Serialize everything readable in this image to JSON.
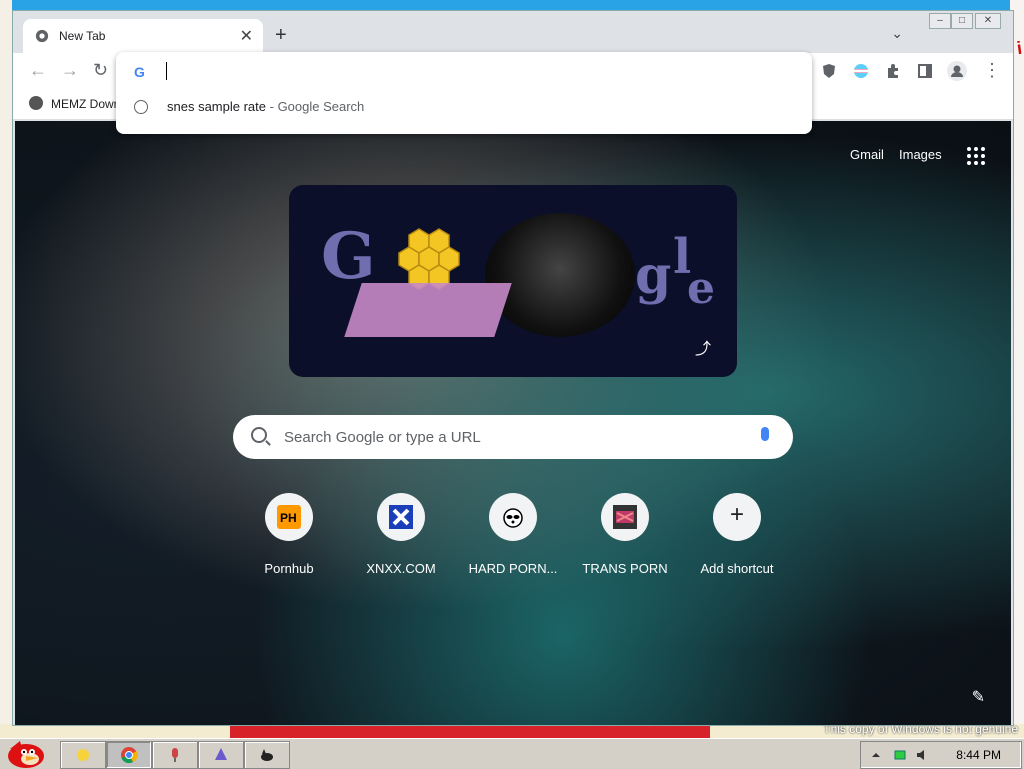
{
  "window": {
    "tab_title": "New Tab",
    "tab_close": "✕",
    "new_tab": "+",
    "tab_search": "⌄",
    "controls": {
      "minimize": "–",
      "maximize": "□",
      "close": "✕"
    }
  },
  "toolbar": {
    "back": "←",
    "forward": "→",
    "reload": "↻",
    "menu": "⋮",
    "extensions": [
      "ublock-icon",
      "pride-extension-icon",
      "puzzle-extension-icon",
      "side-panel-icon",
      "profile-icon"
    ]
  },
  "bookmarks": [
    {
      "label": "MEMZ Down"
    }
  ],
  "omnibox": {
    "value": "",
    "engine_glyph": "G",
    "suggestion": {
      "query": "snes sample rate",
      "separator": " - ",
      "engine": "Google Search"
    }
  },
  "ntp": {
    "links": {
      "gmail": "Gmail",
      "images": "Images"
    },
    "doodle": {
      "letters": [
        "G",
        "g",
        "l",
        "e"
      ],
      "share": "⤴"
    },
    "search_placeholder": "Search Google or type a URL",
    "shortcuts": [
      {
        "label": "Pornhub",
        "icon": "ph-icon"
      },
      {
        "label": "XNXX.COM",
        "icon": "xnxx-icon"
      },
      {
        "label": "HARD PORN...",
        "icon": "raccoon-icon"
      },
      {
        "label": "TRANS PORN",
        "icon": "trans-porn-icon"
      },
      {
        "label": "Add shortcut",
        "icon": "plus-icon"
      }
    ],
    "add_glyph": "+",
    "customize_glyph": "✎"
  },
  "desktop": {
    "genuine_notice": "This copy of Windows is not genuine",
    "red_text": "i"
  },
  "taskbar": {
    "clock": "8:44 PM",
    "tasks": [
      "sun-app-icon",
      "chrome-icon",
      "microphone-app-icon",
      "bird-app-icon",
      "cat-app-icon"
    ]
  },
  "colors": {
    "accent": "#4285f4",
    "taskbar": "#d4d0c8",
    "window_frame": "#dee1e6"
  }
}
